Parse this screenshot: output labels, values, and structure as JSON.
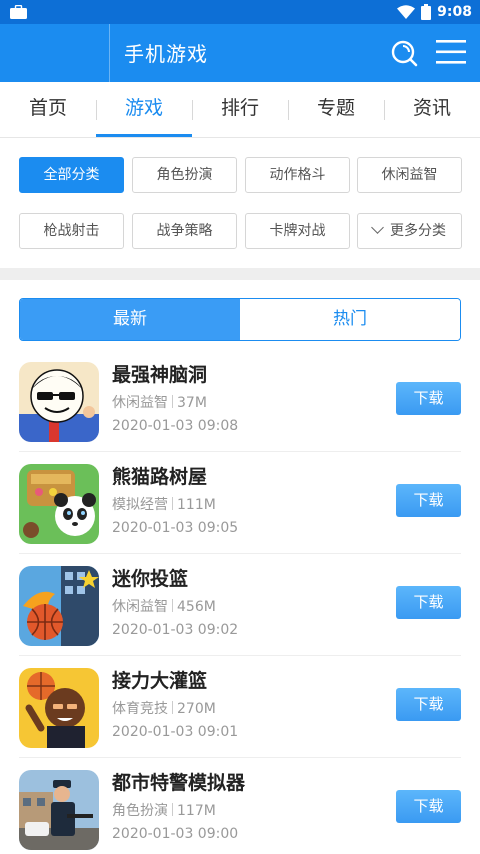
{
  "status_bar": {
    "time": "9:08"
  },
  "header": {
    "title": "手机游戏"
  },
  "nav": {
    "tabs": [
      "首页",
      "游戏",
      "排行",
      "专题",
      "资讯"
    ],
    "active_index": 1
  },
  "categories": {
    "row1": [
      "全部分类",
      "角色扮演",
      "动作格斗",
      "休闲益智"
    ],
    "row2": [
      "枪战射击",
      "战争策略",
      "卡牌对战",
      "更多分类"
    ],
    "active": "全部分类"
  },
  "segment": {
    "tabs": [
      "最新",
      "热门"
    ],
    "active_index": 0
  },
  "games": [
    {
      "name": "最强神脑洞",
      "category": "休闲益智",
      "size": "37M",
      "date": "2020-01-03 09:08",
      "button": "下载"
    },
    {
      "name": "熊猫路树屋",
      "category": "模拟经营",
      "size": "111M",
      "date": "2020-01-03 09:05",
      "button": "下载"
    },
    {
      "name": "迷你投篮",
      "category": "休闲益智",
      "size": "456M",
      "date": "2020-01-03 09:02",
      "button": "下载"
    },
    {
      "name": "接力大灌篮",
      "category": "体育竞技",
      "size": "270M",
      "date": "2020-01-03 09:01",
      "button": "下载"
    },
    {
      "name": "都市特警模拟器",
      "category": "角色扮演",
      "size": "117M",
      "date": "2020-01-03 09:00",
      "button": "下载"
    }
  ],
  "colors": {
    "brand": "#1b8cf0",
    "status_bar": "#0d6fd6",
    "button": "#3a9af2"
  }
}
